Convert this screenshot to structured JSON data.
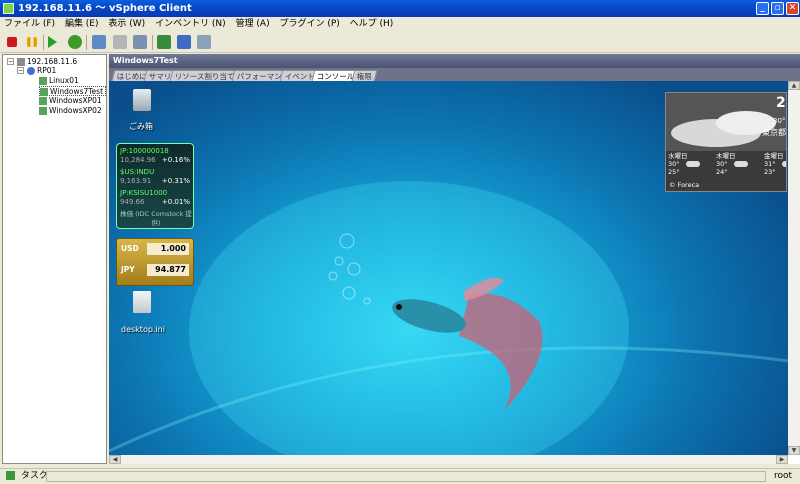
{
  "window": {
    "title": "192.168.11.6 ～ vSphere Client"
  },
  "menu": [
    "ファイル (F)",
    "編集 (E)",
    "表示 (W)",
    "インベントリ (N)",
    "管理 (A)",
    "プラグイン (P)",
    "ヘルプ (H)"
  ],
  "inventory": {
    "host": "192.168.11.6",
    "pool": "RP01",
    "vms": [
      "Linux01",
      "Windows7Test",
      "WindowsXP01",
      "WindowsXP02"
    ]
  },
  "panel": {
    "title": "Windows7Test",
    "tabs": [
      "はじめに",
      "サマリ",
      "リソース割り当て",
      "パフォーマンス",
      "イベント",
      "コンソール",
      "権限"
    ],
    "active_tab": "コンソール"
  },
  "desktop": {
    "recycle_label": "ごみ箱",
    "file_label": "desktop.ini",
    "stocks": [
      {
        "name": "JP:100000018",
        "value": "10,284.96",
        "change": "+0.16%"
      },
      {
        "name": "$US:INDU",
        "value": "9,163.91",
        "change": "+0.31%"
      },
      {
        "name": "JP:KSISU1000",
        "value": "949.66",
        "change": "+0.01%"
      }
    ],
    "stock_footer": "株価 (IDC Comstock 提供)",
    "currency": {
      "from": "USD",
      "from_value": "1.000",
      "to": "JPY",
      "to_value": "94.877"
    },
    "weather": {
      "temp_now": "2",
      "partial_temp": "30°",
      "city": "東京都",
      "days": [
        {
          "day": "水曜日",
          "hi": "30°",
          "lo": "25°"
        },
        {
          "day": "木曜日",
          "hi": "30°",
          "lo": "24°"
        },
        {
          "day": "金曜日",
          "hi": "31°",
          "lo": "23°"
        }
      ],
      "source": "© Foreca"
    }
  },
  "status": {
    "tasks": "タスク",
    "user": "root"
  },
  "colors": {
    "accent": "#0849c8",
    "desktop": "#14a8d8"
  }
}
